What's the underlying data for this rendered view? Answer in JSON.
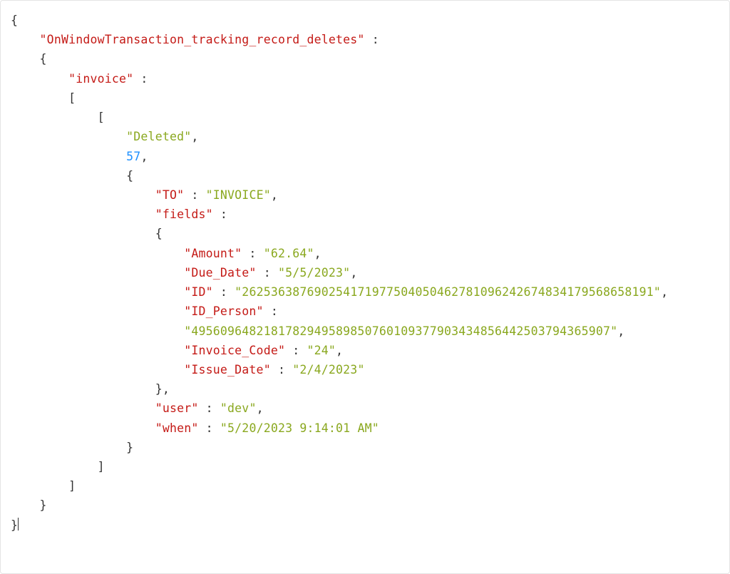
{
  "code": {
    "root_key": "\"OnWindowTransaction_tracking_record_deletes\"",
    "colon_sp": " : ",
    "invoice_key": "\"invoice\"",
    "deleted_str": "\"Deleted\"",
    "num_57": "57",
    "to_key": "\"TO\"",
    "to_val": "\"INVOICE\"",
    "fields_key": "\"fields\"",
    "amount_key": "\"Amount\"",
    "amount_val": "\"62.64\"",
    "due_key": "\"Due_Date\"",
    "due_val": "\"5/5/2023\"",
    "id_key": "\"ID\"",
    "id_val": "\"262536387690254171977504050462781096242674834179568658191\"",
    "idp_key": "\"ID_Person\"",
    "idp_val": "\"4956096482181782949589850760109377903434856442503794365907\"",
    "inv_key": "\"Invoice_Code\"",
    "inv_val": "\"24\"",
    "issue_key": "\"Issue_Date\"",
    "issue_val": "\"2/4/2023\"",
    "user_key": "\"user\"",
    "user_val": "\"dev\"",
    "when_key": "\"when\"",
    "when_val": "\"5/20/2023 9:14:01 AM\"",
    "brace_o": "{",
    "brace_c": "}",
    "brack_o": "[",
    "brack_c": "]",
    "comma": ",",
    "colon": " :",
    "i1": "    ",
    "i2": "        ",
    "i3": "            ",
    "i4": "                ",
    "i5": "                    ",
    "i6": "                        "
  }
}
